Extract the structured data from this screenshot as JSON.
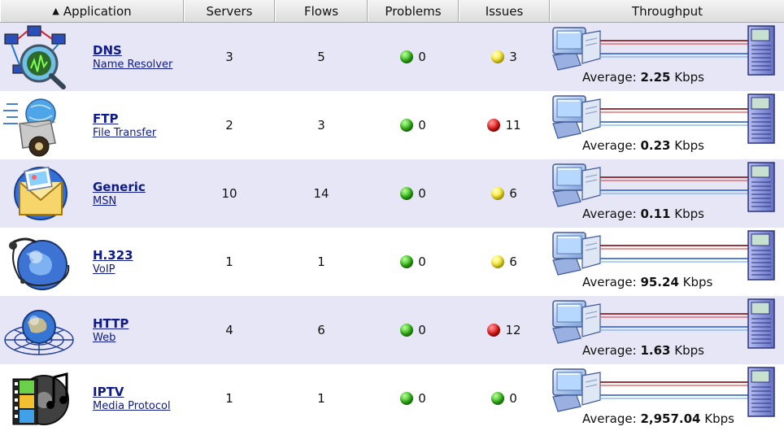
{
  "header": {
    "sort_icon": "▲",
    "application": "Application",
    "servers": "Servers",
    "flows": "Flows",
    "problems": "Problems",
    "issues": "Issues",
    "throughput": "Throughput"
  },
  "throughput_prefix": "Average:",
  "rows": [
    {
      "name": "DNS",
      "desc": "Name Resolver",
      "icon": "dns-icon",
      "servers": "3",
      "flows": "5",
      "problems": "0",
      "problems_status": "green",
      "issues": "3",
      "issues_status": "yellow",
      "avg_value": "2.25",
      "avg_unit": "Kbps"
    },
    {
      "name": "FTP",
      "desc": "File Transfer",
      "icon": "ftp-icon",
      "servers": "2",
      "flows": "3",
      "problems": "0",
      "problems_status": "green",
      "issues": "11",
      "issues_status": "red",
      "avg_value": "0.23",
      "avg_unit": "Kbps"
    },
    {
      "name": "Generic",
      "desc": "MSN",
      "icon": "generic-icon",
      "servers": "10",
      "flows": "14",
      "problems": "0",
      "problems_status": "green",
      "issues": "6",
      "issues_status": "yellow",
      "avg_value": "0.11",
      "avg_unit": "Kbps"
    },
    {
      "name": "H.323",
      "desc": "VoIP",
      "icon": "h323-icon",
      "servers": "1",
      "flows": "1",
      "problems": "0",
      "problems_status": "green",
      "issues": "6",
      "issues_status": "yellow",
      "avg_value": "95.24",
      "avg_unit": "Kbps"
    },
    {
      "name": "HTTP",
      "desc": "Web",
      "icon": "http-icon",
      "servers": "4",
      "flows": "6",
      "problems": "0",
      "problems_status": "green",
      "issues": "12",
      "issues_status": "red",
      "avg_value": "1.63",
      "avg_unit": "Kbps"
    },
    {
      "name": "IPTV",
      "desc": "Media Protocol",
      "icon": "iptv-icon",
      "servers": "1",
      "flows": "1",
      "problems": "0",
      "problems_status": "green",
      "issues": "0",
      "issues_status": "green",
      "avg_value": "2,957.04",
      "avg_unit": "Kbps"
    }
  ],
  "colors": {
    "row_odd": "#e6e6f6",
    "row_even": "#ffffff",
    "link": "#0d1a87",
    "link_red": "#c61818",
    "link_blue": "#2a5fd0"
  }
}
